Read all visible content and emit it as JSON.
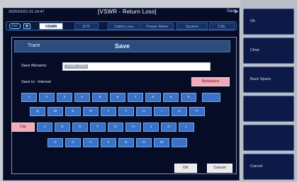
{
  "statusbar": {
    "timestamp": "2020/01/01 01:14:47",
    "title": "[VSWR - Return Loss]",
    "save_label": "Save",
    "save_arrow": "▶"
  },
  "tabbar": {
    "esc_label": "ESC",
    "save_icon": "▣",
    "tabs": [
      {
        "label": "VSWR",
        "active": true
      },
      {
        "label": "DTF",
        "active": false
      },
      {
        "label": "Cable Loss",
        "active": false
      },
      {
        "label": "Power Meter",
        "active": false
      },
      {
        "label": "System",
        "active": false
      },
      {
        "label": "CAL",
        "active": false
      }
    ]
  },
  "panel": {
    "header_label": "Trace",
    "header_title": "Save",
    "filename_label": "Save filename:",
    "filename_value": "VSWR_0000",
    "save_to_label": "Save to : Internal",
    "backspace_label": "Backspace",
    "cap_label": "Cap",
    "ok_label": "OK",
    "cancel_label": "Cancel"
  },
  "keyboard": {
    "row1": [
      "1",
      "2",
      "3",
      "4",
      "5",
      "6",
      "7",
      "8",
      "9",
      "0"
    ],
    "row2": [
      "Q",
      "W",
      "E",
      "R",
      "T",
      "Y",
      "U",
      "I",
      "O",
      "P"
    ],
    "row3": [
      "A",
      "S",
      "D",
      "F",
      "G",
      "H",
      "J",
      "K",
      "L"
    ],
    "row4": [
      "Z",
      "X",
      "C",
      "V",
      "B",
      "N",
      "M"
    ]
  },
  "softkeys": [
    {
      "label": "Ok"
    },
    {
      "label": "Clear"
    },
    {
      "label": "Back Space"
    },
    {
      "label": ""
    },
    {
      "label": ""
    },
    {
      "label": "Cancel"
    }
  ]
}
